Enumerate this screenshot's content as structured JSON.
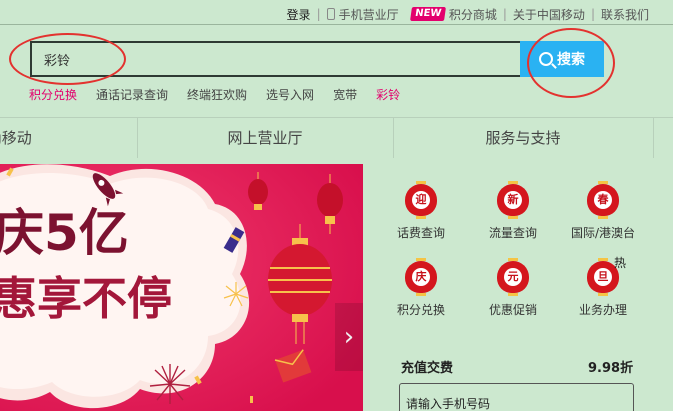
{
  "topnav": {
    "login": "登录",
    "mobile_hall": "手机营业厅",
    "new_badge": "NEW",
    "points_mall": "积分商城",
    "about": "关于中国移动",
    "contact": "联系我们"
  },
  "search": {
    "value": "彩铃",
    "button_label": "搜索"
  },
  "hot_links": [
    "积分兑换",
    "通话记录查询",
    "终端狂欢购",
    "选号入网",
    "宽带",
    "彩铃"
  ],
  "nav": {
    "item_left": "g移动",
    "online_hall": "网上营业厅",
    "service_support": "服务与支持"
  },
  "banner": {
    "headline_top": "庆5亿",
    "headline_bottom": "惠享不停",
    "arrow": "›"
  },
  "services": [
    {
      "char": "迎",
      "label": "话费查询"
    },
    {
      "char": "新",
      "label": "流量查询"
    },
    {
      "char": "春",
      "label": "国际/港澳台"
    },
    {
      "char": "庆",
      "label": "积分兑换"
    },
    {
      "char": "元",
      "label": "优惠促销"
    },
    {
      "char": "旦",
      "label": "业务办理"
    }
  ],
  "hot_mark": "热",
  "recharge": {
    "title": "充值交费",
    "discount": "9.98折",
    "phone_placeholder": "请输入手机号码"
  },
  "colors": {
    "background": "#cce8cf",
    "accent_blue": "#2ab2f2",
    "brand_pink": "#e3006d",
    "banner_red": "#e01a58",
    "annotation_red": "#e3322f"
  }
}
